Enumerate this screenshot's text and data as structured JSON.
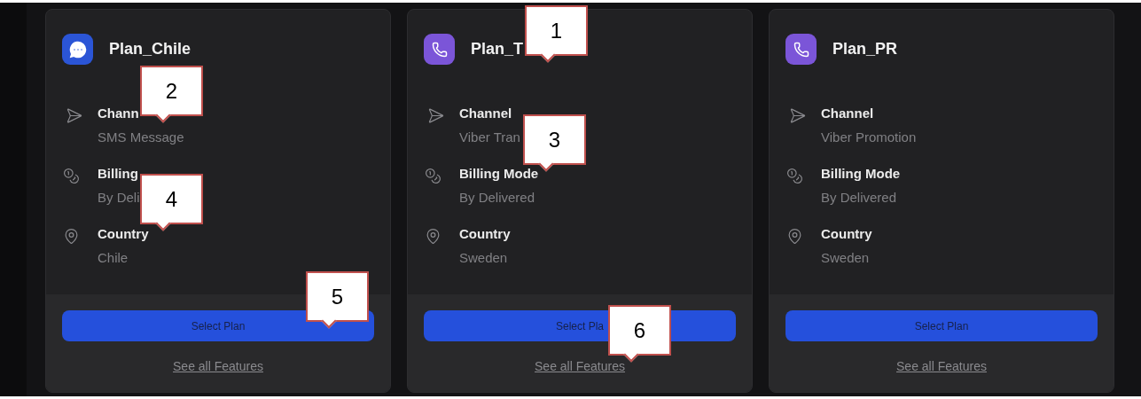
{
  "plans": [
    {
      "kind": "sms",
      "title": "Plan_Chile",
      "details": [
        {
          "kind": "channel",
          "label": "Chann",
          "value": "SMS Message"
        },
        {
          "kind": "billing",
          "label": "Billing",
          "value": "By Deli"
        },
        {
          "kind": "country",
          "label": "Country",
          "value": "Chile"
        }
      ],
      "button": "Select Plan",
      "link": "See all Features"
    },
    {
      "kind": "viber",
      "title": "Plan_T",
      "details": [
        {
          "kind": "channel",
          "label": "Channel",
          "value": "Viber Tran"
        },
        {
          "kind": "billing",
          "label": "Billing Mode",
          "value": "By Delivered"
        },
        {
          "kind": "country",
          "label": "Country",
          "value": "Sweden"
        }
      ],
      "button": "Select Pla",
      "link": "See all Features"
    },
    {
      "kind": "viber",
      "title": "Plan_PR",
      "details": [
        {
          "kind": "channel",
          "label": "Channel",
          "value": "Viber Promotion"
        },
        {
          "kind": "billing",
          "label": "Billing Mode",
          "value": "By Delivered"
        },
        {
          "kind": "country",
          "label": "Country",
          "value": "Sweden"
        }
      ],
      "button": "Select Plan",
      "link": "See all Features"
    }
  ],
  "callouts": [
    "1",
    "2",
    "3",
    "4",
    "5",
    "6"
  ]
}
